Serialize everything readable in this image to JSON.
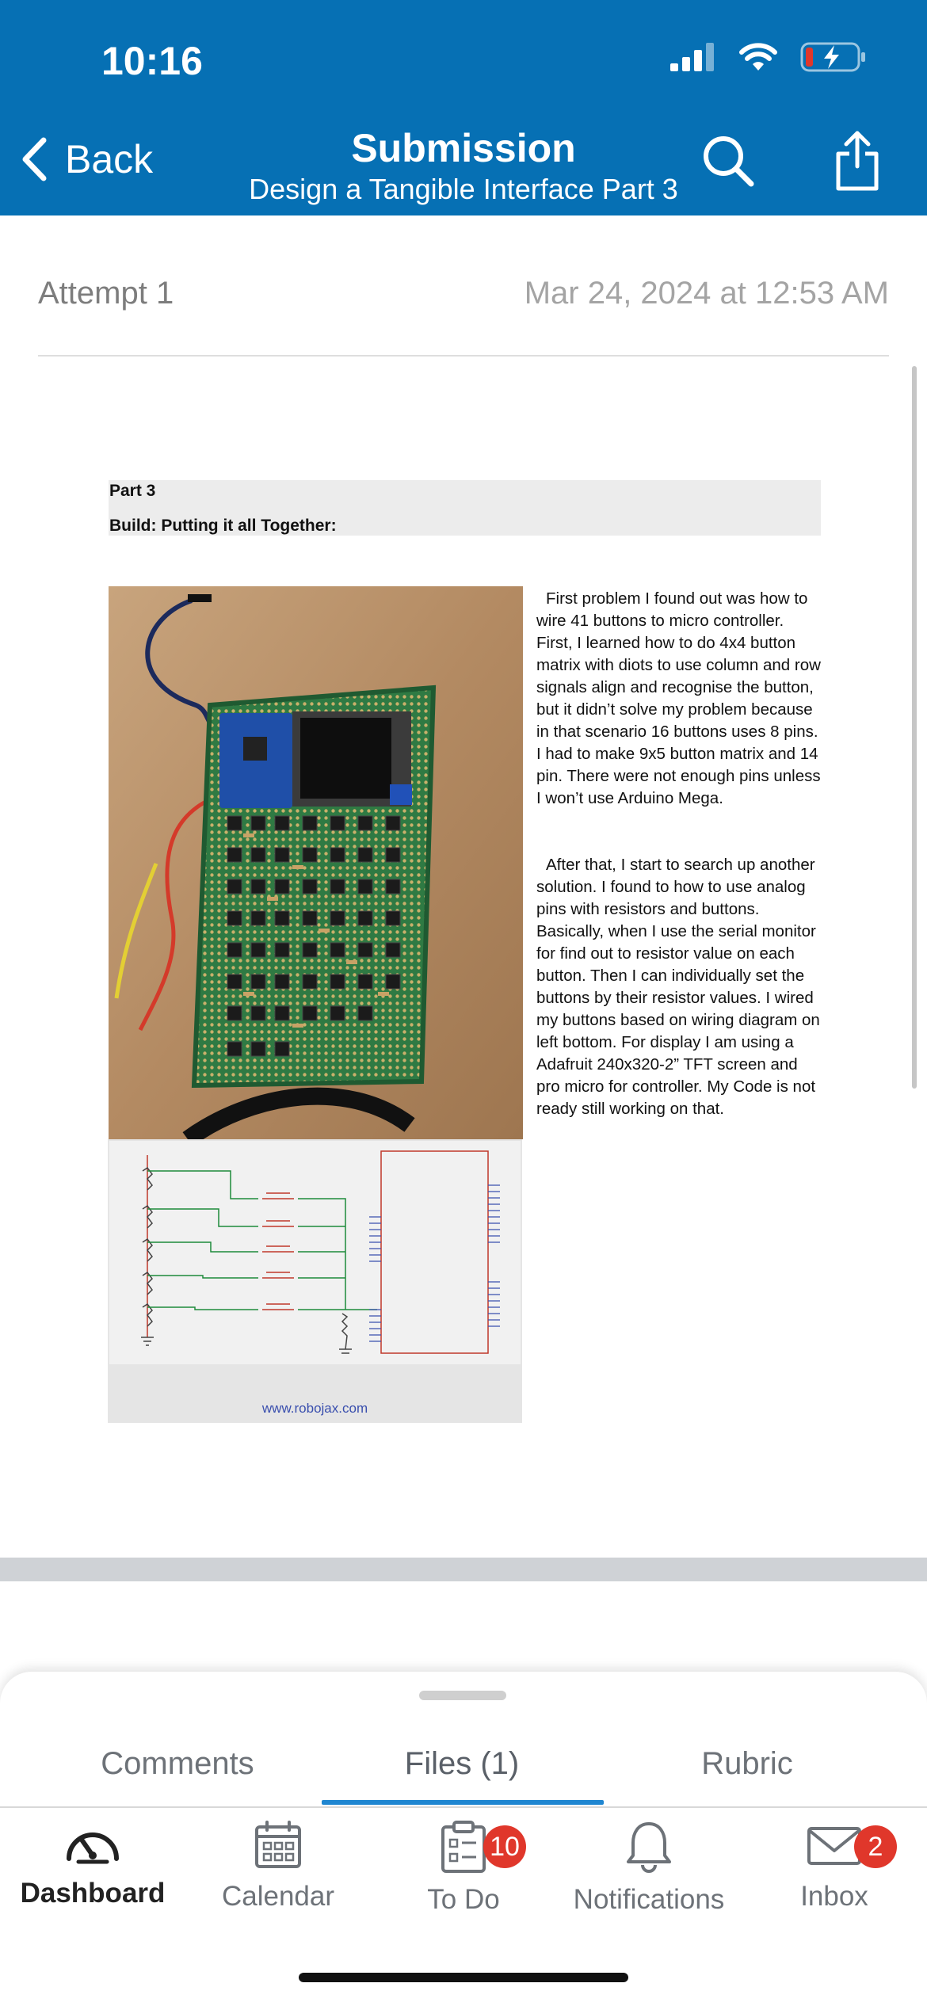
{
  "status_bar": {
    "time": "10:16"
  },
  "nav": {
    "back_label": "Back",
    "title": "Submission",
    "subtitle": "Design a Tangible Interface Part 3"
  },
  "attempt": {
    "label": "Attempt 1",
    "date": "Mar 24, 2024 at 12:53 AM"
  },
  "document": {
    "part": "Part 3",
    "section": "Build: Putting it all Together:",
    "paragraph1": "First problem I found out was how to wire 41 buttons to micro controller. First, I learned how to do 4x4 button matrix with diots to use column and row signals align and recognise the button, but it didn’t solve my problem because in that scenario 16 buttons uses 8 pins. I had to make 9x5 button matrix and 14 pin. There were not enough pins unless I won’t use Arduino Mega.",
    "paragraph2": "After that, I start to search up another solution. I found to how to use analog pins with resistors and buttons. Basically, when I use the serial monitor for find out to resistor value on each button. Then I can individually set the buttons by their resistor values. I wired my buttons based on wiring diagram on left bottom. For display I am using a Adafruit 240x320-2” TFT screen and pro micro for controller. My Code is not ready still working on that.",
    "diagram_url": "www.robojax.com"
  },
  "sheet_tabs": [
    {
      "label": "Comments"
    },
    {
      "label": "Files (1)"
    },
    {
      "label": "Rubric"
    }
  ],
  "tabbar": [
    {
      "label": "Dashboard",
      "icon": "dashboard-icon"
    },
    {
      "label": "Calendar",
      "icon": "calendar-icon"
    },
    {
      "label": "To Do",
      "icon": "todo-icon",
      "badge": "10"
    },
    {
      "label": "Notifications",
      "icon": "bell-icon"
    },
    {
      "label": "Inbox",
      "icon": "mail-icon",
      "badge": "2"
    }
  ],
  "colors": {
    "brand": "#0670b4",
    "active_tab": "#1f86d1",
    "badge": "#e0372b"
  }
}
